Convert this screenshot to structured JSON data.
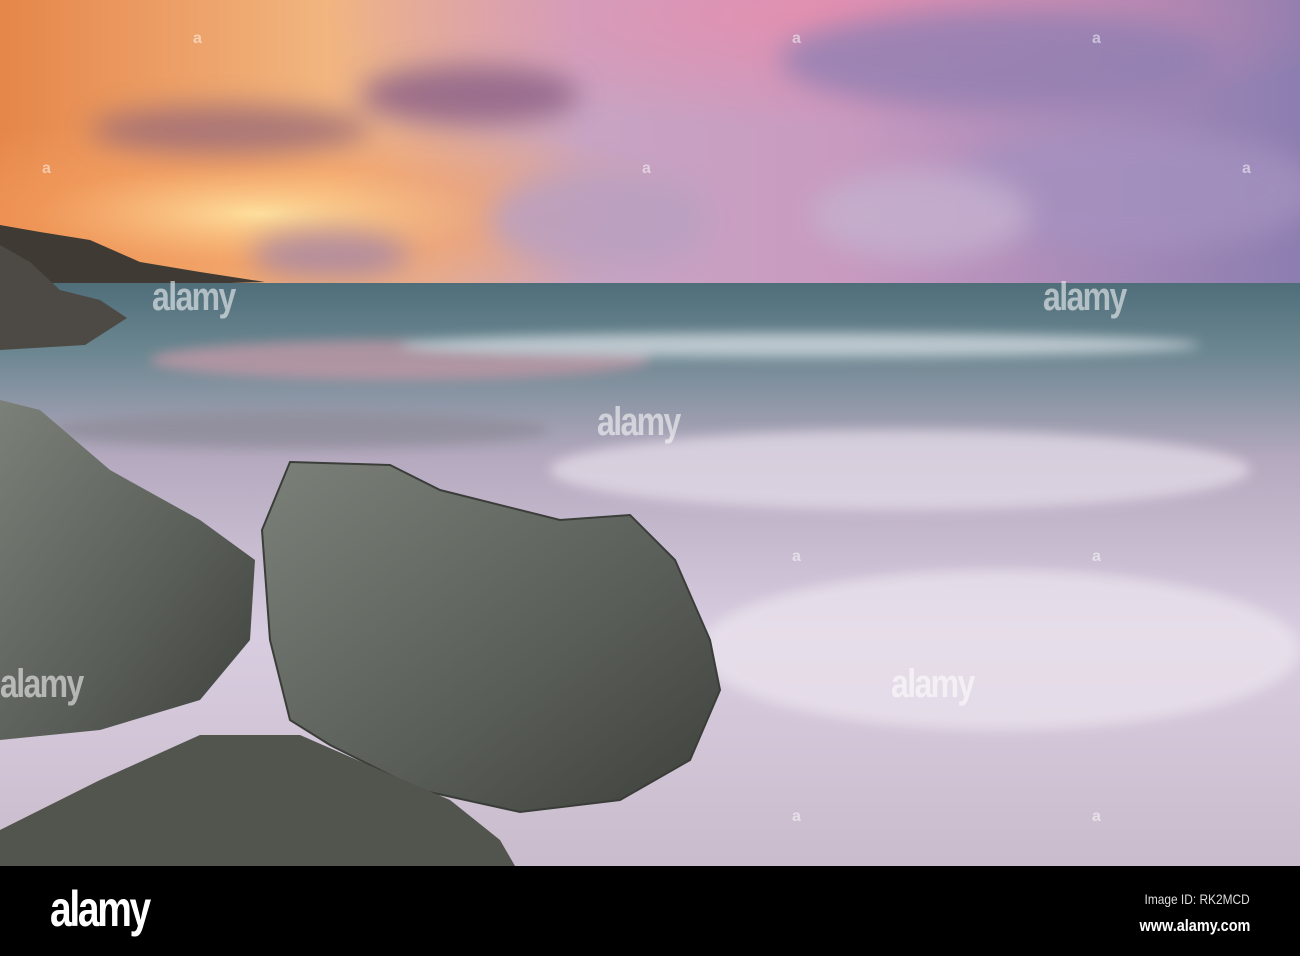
{
  "scene": {
    "description_colors": {
      "sky_left": "#f29a4a",
      "sky_mid": "#c9a0c8",
      "sky_right": "#8f7fb0",
      "sea": "#5f7a86",
      "foam": "#d9cfde",
      "rock": "#5d625a"
    }
  },
  "watermark": {
    "text": "alamy",
    "small_mark": "a"
  },
  "footer": {
    "logo": "alamy",
    "image_id": "Image ID: RK2MCD",
    "url": "www.alamy.com"
  }
}
